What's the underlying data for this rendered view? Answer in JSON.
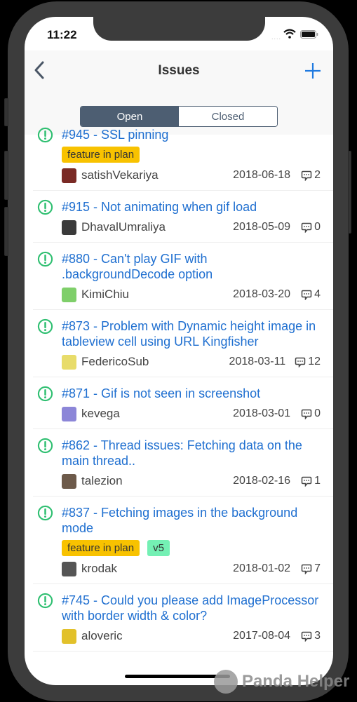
{
  "status_bar": {
    "time": "11:22",
    "signal": "....",
    "wifi": "wifi-icon",
    "battery": "battery-icon"
  },
  "nav": {
    "back_icon": "chevron-left-icon",
    "title": "Issues",
    "add_icon": "plus-icon",
    "accent_color": "#1f6fd0"
  },
  "segments": [
    {
      "label": "Open",
      "active": true
    },
    {
      "label": "Closed",
      "active": false
    }
  ],
  "colors": {
    "open_icon": "#2fbf71",
    "title_link": "#1f6fd0",
    "segment": "#4d5e72",
    "label_feature": "#f8c200",
    "label_v5": "#74f0b4"
  },
  "issues": [
    {
      "title": "#945 - SSL pinning",
      "labels": [
        {
          "text": "feature in plan",
          "color": "#f8c200"
        }
      ],
      "author": "satishVekariya",
      "avatar_color": "#7a2a25",
      "date": "2018-06-18",
      "comments": "2"
    },
    {
      "title": "#915 - Not animating when gif load",
      "labels": [],
      "author": "DhavalUmraliya",
      "avatar_color": "#3a3a3a",
      "date": "2018-05-09",
      "comments": "0"
    },
    {
      "title": "#880 - Can't play GIF with .backgroundDecode option",
      "labels": [],
      "author": "KimiChiu",
      "avatar_color": "#7fcf6a",
      "date": "2018-03-20",
      "comments": "4"
    },
    {
      "title": "#873 - Problem with Dynamic height image in tableview cell using URL Kingfisher",
      "labels": [],
      "author": "FedericoSub",
      "avatar_color": "#e8dc6a",
      "date": "2018-03-11",
      "comments": "12"
    },
    {
      "title": "#871 - Gif is not seen in screenshot",
      "labels": [],
      "author": "kevega",
      "avatar_color": "#8c86d8",
      "date": "2018-03-01",
      "comments": "0"
    },
    {
      "title": "#862 - Thread issues: Fetching data on the main thread..",
      "labels": [],
      "author": "talezion",
      "avatar_color": "#6d5a4a",
      "date": "2018-02-16",
      "comments": "1"
    },
    {
      "title": "#837 - Fetching images in the background mode",
      "labels": [
        {
          "text": "feature in plan",
          "color": "#f8c200"
        },
        {
          "text": "v5",
          "color": "#74f0b4"
        }
      ],
      "author": "krodak",
      "avatar_color": "#555555",
      "date": "2018-01-02",
      "comments": "7"
    },
    {
      "title": "#745 - Could you please add ImageProcessor with border width & color?",
      "labels": [],
      "author": "aloveric",
      "avatar_color": "#e2c12a",
      "date": "2017-08-04",
      "comments": "3"
    }
  ],
  "watermark": "Panda Helper"
}
